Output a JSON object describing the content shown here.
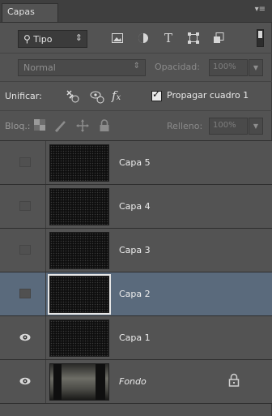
{
  "panel": {
    "tab_title": "Capas",
    "menu_icon": "panel-menu-icon"
  },
  "filter": {
    "kind_label": "Tipo",
    "buttons": [
      "image-filter-icon",
      "adjustment-filter-icon",
      "type-filter-icon",
      "shape-filter-icon",
      "smart-object-filter-icon"
    ]
  },
  "blend": {
    "mode": "Normal",
    "opacity_label": "Opacidad:",
    "opacity_value": "100%"
  },
  "unify": {
    "label": "Unificar:",
    "propagate_label": "Propagar cuadro 1",
    "propagate_checked": true
  },
  "lock": {
    "label": "Bloq.:",
    "fill_label": "Relleno:",
    "fill_value": "100%"
  },
  "layers": [
    {
      "name": "Capa 5",
      "visible": false,
      "selected": false
    },
    {
      "name": "Capa 4",
      "visible": false,
      "selected": false
    },
    {
      "name": "Capa 3",
      "visible": false,
      "selected": false
    },
    {
      "name": "Capa 2",
      "visible": false,
      "selected": true
    },
    {
      "name": "Capa 1",
      "visible": true,
      "selected": false
    },
    {
      "name": "Fondo",
      "visible": true,
      "selected": false,
      "locked": true
    }
  ],
  "colors": {
    "panel_bg": "#535353",
    "selected_row": "#5a6a7c"
  }
}
